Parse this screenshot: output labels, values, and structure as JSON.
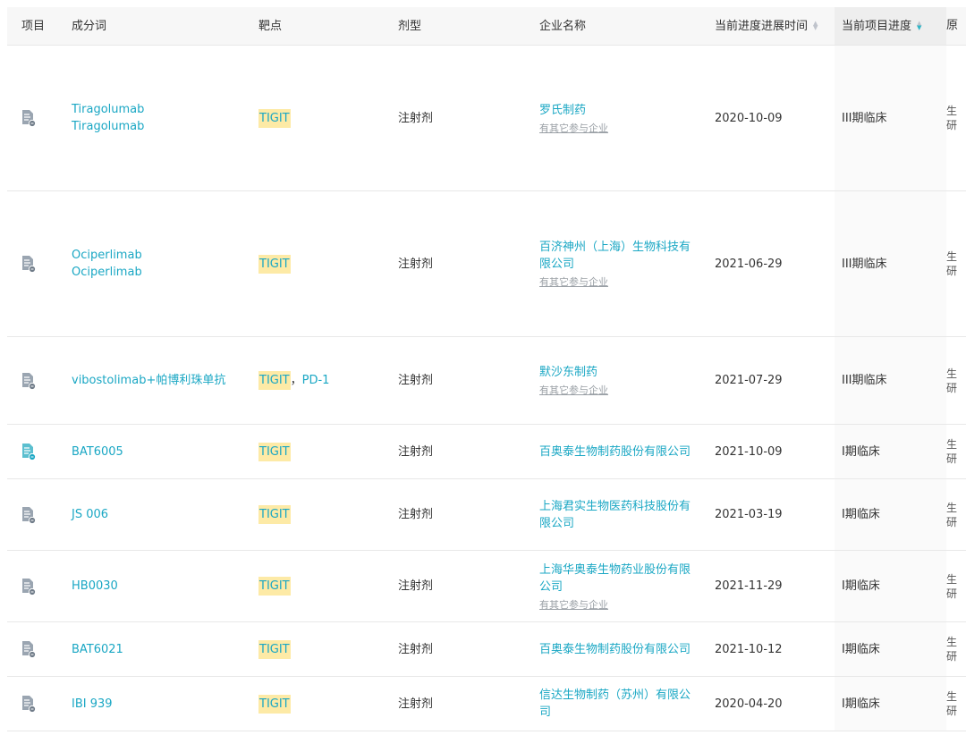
{
  "headers": {
    "project": "项目",
    "ingredient": "成分词",
    "target": "靶点",
    "dosage": "剂型",
    "company": "企业名称",
    "progress_time": "当前进度进展时间",
    "progress": "当前项目进度",
    "cut_col": "原"
  },
  "colors": {
    "link": "#1aa7c4",
    "highlight": "#fdeaa6",
    "sort_active": "#2fb6c7"
  },
  "icons": {
    "row_icon": "document-icon",
    "sort": "sort-caret-icon"
  },
  "rows": [
    {
      "names": [
        "Tiragolumab",
        "Tiragolumab"
      ],
      "targets": [
        "TIGIT"
      ],
      "dosage": "注射剂",
      "company": "罗氏制药",
      "company_sub": "有其它参与企业",
      "time": "2020-10-09",
      "progress": "III期临床",
      "cut": "生\n研"
    },
    {
      "names": [
        "Ociperlimab",
        "Ociperlimab"
      ],
      "targets": [
        "TIGIT"
      ],
      "dosage": "注射剂",
      "company": "百济神州（上海）生物科技有限公司",
      "company_sub": "有其它参与企业",
      "time": "2021-06-29",
      "progress": "III期临床",
      "cut": "生\n研"
    },
    {
      "names": [
        "vibostolimab+帕博利珠单抗"
      ],
      "targets": [
        "TIGIT",
        "PD-1"
      ],
      "dosage": "注射剂",
      "company": "默沙东制药",
      "company_sub": "有其它参与企业",
      "time": "2021-07-29",
      "progress": "III期临床",
      "cut": "生\n研"
    },
    {
      "names": [
        "BAT6005"
      ],
      "targets": [
        "TIGIT"
      ],
      "dosage": "注射剂",
      "company": "百奥泰生物制药股份有限公司",
      "company_sub": "",
      "time": "2021-10-09",
      "progress": "I期临床",
      "cut": "生\n研"
    },
    {
      "names": [
        "JS 006"
      ],
      "targets": [
        "TIGIT"
      ],
      "dosage": "注射剂",
      "company": "上海君实生物医药科技股份有限公司",
      "company_sub": "",
      "time": "2021-03-19",
      "progress": "I期临床",
      "cut": "生\n研"
    },
    {
      "names": [
        "HB0030"
      ],
      "targets": [
        "TIGIT"
      ],
      "dosage": "注射剂",
      "company": "上海华奥泰生物药业股份有限公司",
      "company_sub": "有其它参与企业",
      "time": "2021-11-29",
      "progress": "I期临床",
      "cut": "生\n研"
    },
    {
      "names": [
        "BAT6021"
      ],
      "targets": [
        "TIGIT"
      ],
      "dosage": "注射剂",
      "company": "百奥泰生物制药股份有限公司",
      "company_sub": "",
      "time": "2021-10-12",
      "progress": "I期临床",
      "cut": "生\n研"
    },
    {
      "names": [
        "IBI 939"
      ],
      "targets": [
        "TIGIT"
      ],
      "dosage": "注射剂",
      "company": "信达生物制药（苏州）有限公司",
      "company_sub": "",
      "time": "2020-04-20",
      "progress": "I期临床",
      "cut": "生\n研"
    }
  ]
}
